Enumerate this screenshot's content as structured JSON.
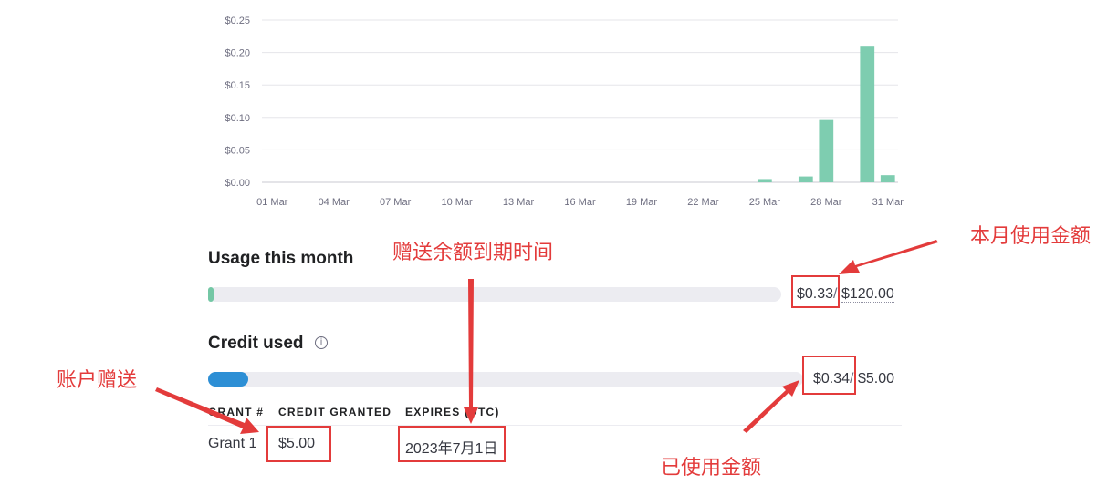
{
  "chart_data": {
    "type": "bar",
    "x_tick_labels": [
      "01 Mar",
      "04 Mar",
      "07 Mar",
      "10 Mar",
      "13 Mar",
      "16 Mar",
      "19 Mar",
      "22 Mar",
      "25 Mar",
      "28 Mar",
      "31 Mar"
    ],
    "y_tick_labels": [
      "$0.00",
      "$0.05",
      "$0.10",
      "$0.15",
      "$0.20",
      "$0.25"
    ],
    "ylim": [
      0,
      0.25
    ],
    "grid": true,
    "bar_color": "#7ecdb0",
    "days": 31,
    "values": [
      0,
      0,
      0,
      0,
      0,
      0,
      0,
      0,
      0,
      0,
      0,
      0,
      0,
      0,
      0,
      0,
      0,
      0,
      0,
      0,
      0,
      0,
      0,
      0,
      0.005,
      0,
      0.009,
      0.096,
      0,
      0.209,
      0.011
    ]
  },
  "usage": {
    "title": "Usage this month",
    "used": "$0.33",
    "separator": "/",
    "limit": "$120.00",
    "fraction": 0.0028,
    "color": "#74c7a5"
  },
  "credit": {
    "title": "Credit used",
    "info_icon": "info-icon",
    "used": "$0.34",
    "separator": "/",
    "total": "$5.00",
    "fraction": 0.068,
    "color": "#2d8fd5"
  },
  "grants": {
    "headers": [
      "GRANT #",
      "CREDIT GRANTED",
      "EXPIRES (UTC)"
    ],
    "rows": [
      {
        "grant": "Grant 1",
        "credit": "$5.00",
        "expires": "2023年7月1日"
      }
    ]
  },
  "annotations": {
    "color": "#e33b3b",
    "month_used": "本月使用金额",
    "expiry": "赠送余额到期时间",
    "account_grant": "账户赠送",
    "used_amount": "已使用金额"
  }
}
